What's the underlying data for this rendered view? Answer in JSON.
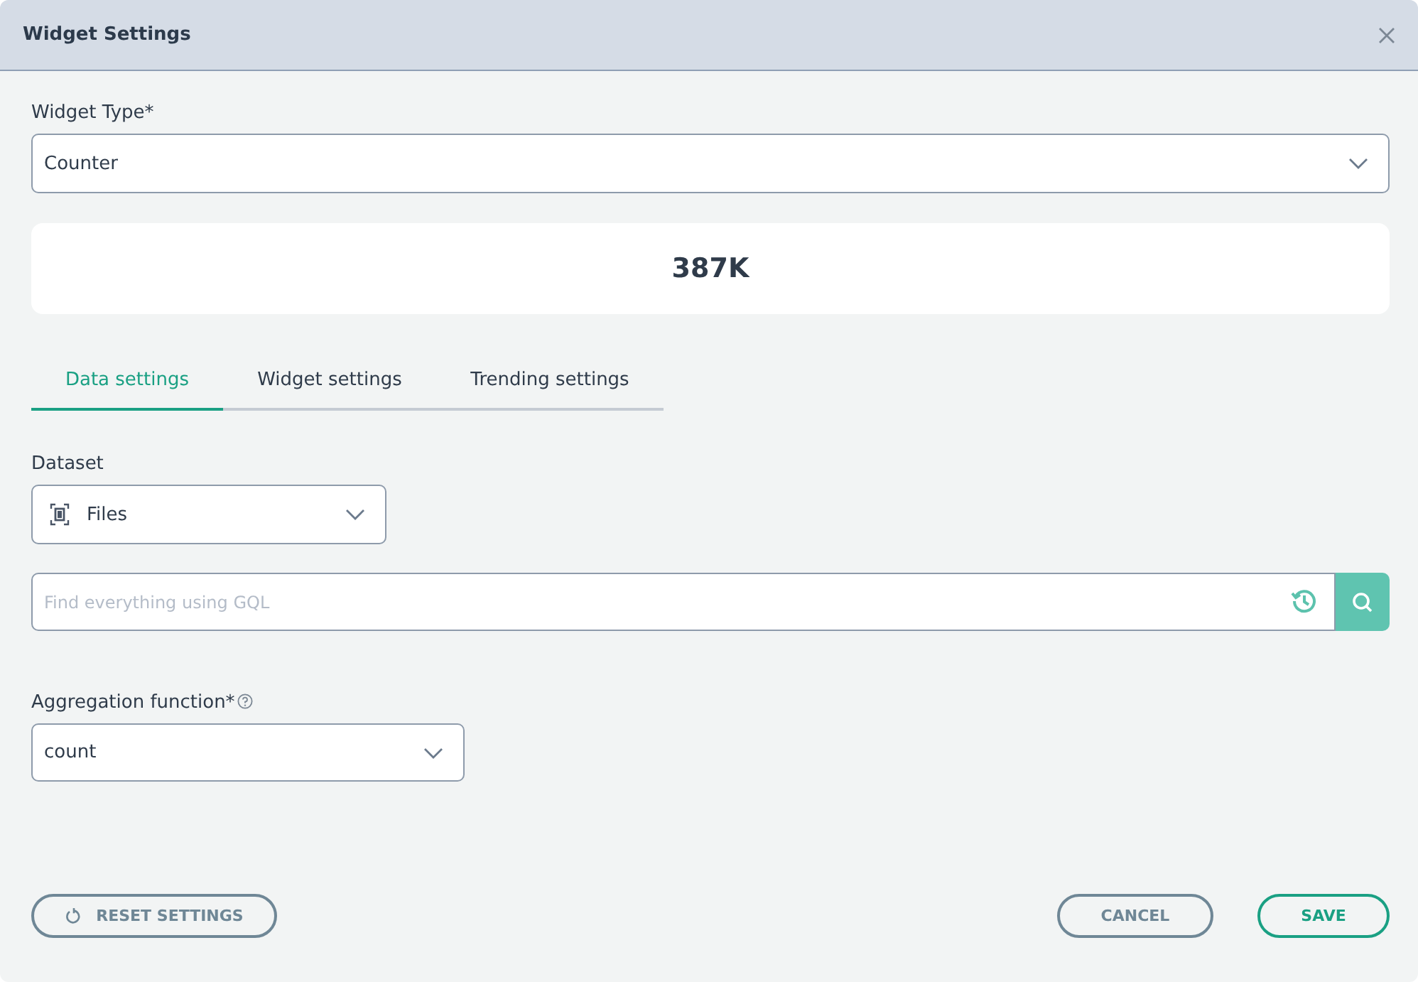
{
  "window": {
    "title": "Widget Settings"
  },
  "widget_type": {
    "label": "Widget Type*",
    "value": "Counter"
  },
  "preview": {
    "value": "387K"
  },
  "tabs": [
    {
      "label": "Data settings",
      "selected": true
    },
    {
      "label": "Widget settings",
      "selected": false
    },
    {
      "label": "Trending settings",
      "selected": false
    }
  ],
  "dataset": {
    "label": "Dataset",
    "value": "Files"
  },
  "search": {
    "placeholder": "Find everything using GQL"
  },
  "aggregation": {
    "label": "Aggregation function*",
    "value": "count"
  },
  "buttons": [
    {
      "label": "RESET SETTINGS",
      "kind": "reset"
    },
    {
      "label": "CANCEL",
      "kind": "cancel"
    },
    {
      "label": "SAVE",
      "kind": "save"
    }
  ]
}
